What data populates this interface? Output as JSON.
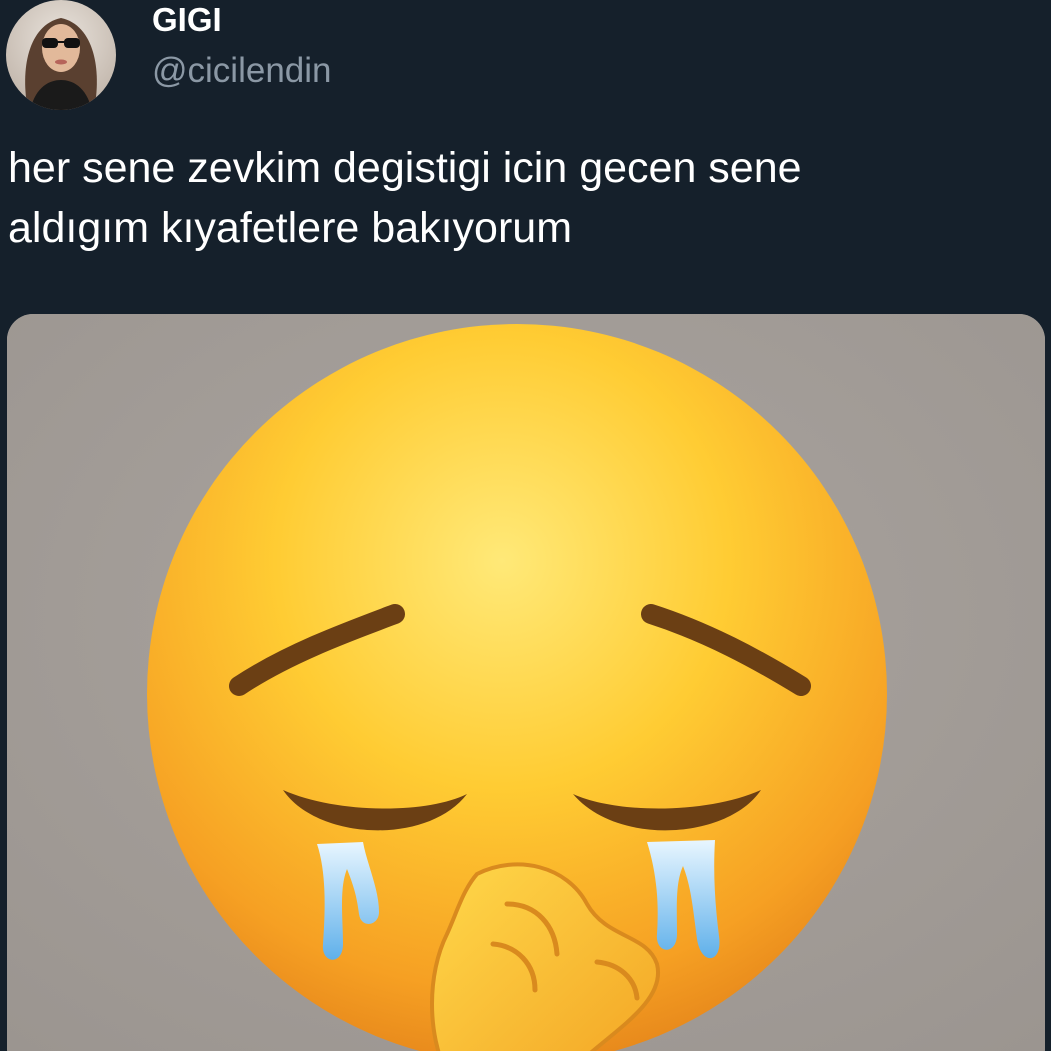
{
  "tweet": {
    "display_name": "GIGI",
    "handle": "@cicilendin",
    "text": "her sene zevkim degistigi icin gecen sene\naldıgım kıyafetlere bakıyorum"
  },
  "media": {
    "icon": "crying-face-emoji",
    "background_color": "#a39d98"
  },
  "colors": {
    "background": "#15202b",
    "name": "#ffffff",
    "handle": "#8b98a5",
    "text": "#ffffff"
  }
}
